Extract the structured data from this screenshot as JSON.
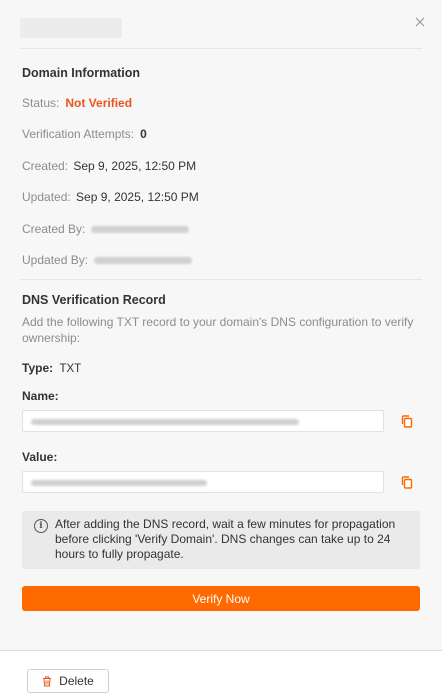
{
  "header": {
    "close_icon": "close-icon"
  },
  "domain_info": {
    "title": "Domain Information",
    "status_label": "Status:",
    "status_value": "Not Verified",
    "attempts_label": "Verification Attempts:",
    "attempts_value": "0",
    "created_label": "Created:",
    "created_value": "Sep 9, 2025, 12:50 PM",
    "updated_label": "Updated:",
    "updated_value": "Sep 9, 2025, 12:50 PM",
    "created_by_label": "Created By:",
    "updated_by_label": "Updated By:"
  },
  "dns_record": {
    "title": "DNS Verification Record",
    "description": "Add the following TXT record to your domain's DNS configuration to verify ownership:",
    "type_label": "Type:",
    "type_value": "TXT",
    "name_label": "Name:",
    "value_label": "Value:"
  },
  "info_note": "After adding the DNS record, wait a few minutes for propagation before clicking 'Verify Domain'. DNS changes can take up to 24 hours to fully propagate.",
  "actions": {
    "verify_label": "Verify Now",
    "delete_label": "Delete"
  },
  "colors": {
    "accent": "#ff6a00",
    "status_not_verified": "#e8561e"
  }
}
